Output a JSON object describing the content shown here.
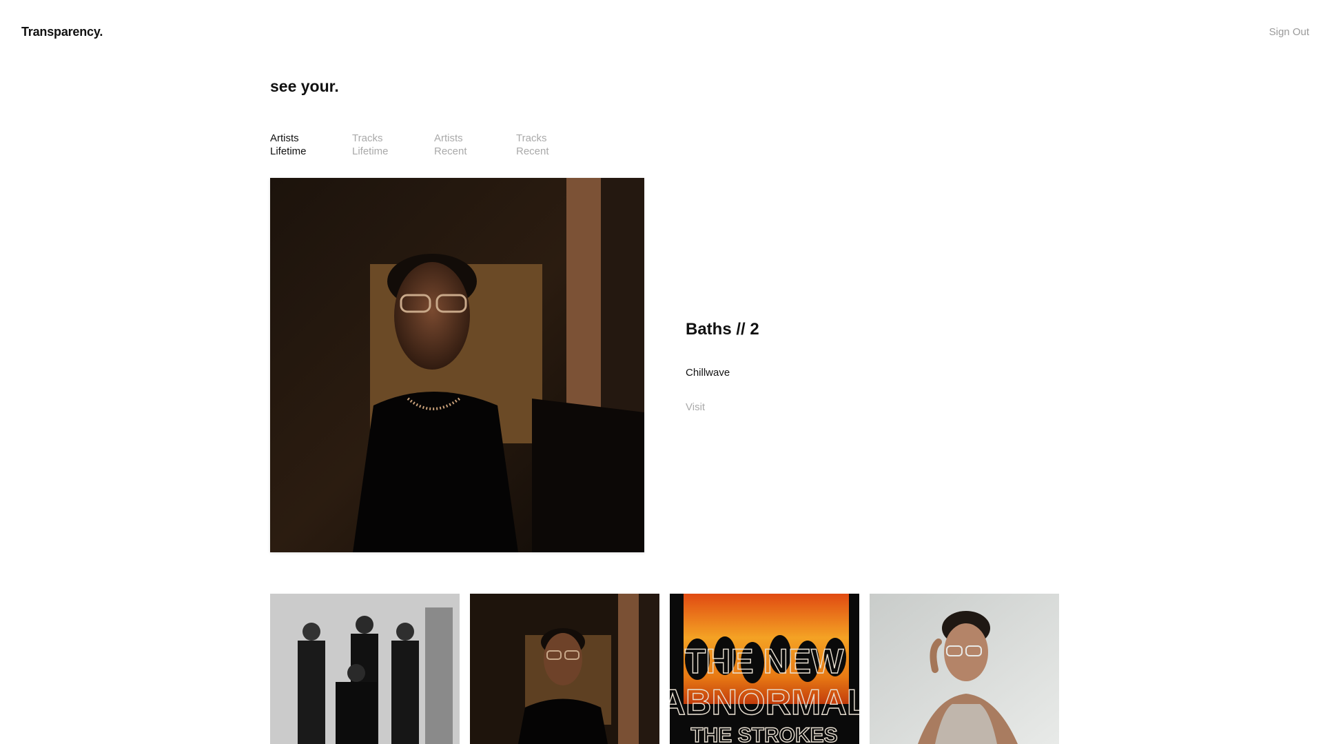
{
  "header": {
    "logo": "Transparency.",
    "sign_out": "Sign Out"
  },
  "heading": "see your.",
  "tabs": [
    {
      "line1": "Artists",
      "line2": "Lifetime",
      "active": true
    },
    {
      "line1": "Tracks",
      "line2": "Lifetime",
      "active": false
    },
    {
      "line1": "Artists",
      "line2": "Recent",
      "active": false
    },
    {
      "line1": "Tracks",
      "line2": "Recent",
      "active": false
    }
  ],
  "featured": {
    "title": "Baths // 2",
    "genre": "Chillwave",
    "visit": "Visit",
    "image": "artist-portrait-warm-light"
  },
  "thumbnails": [
    {
      "image": "band-photo-black-and-white"
    },
    {
      "image": "artist-portrait-warm-light"
    },
    {
      "image": "album-cover-the-new-abnormal",
      "cover_text": [
        "THE NEW",
        "ABNORMAL",
        "THE STROKES"
      ]
    },
    {
      "image": "artist-portrait-glasses-light-background"
    }
  ],
  "colors": {
    "text": "#111111",
    "muted": "#a9a9a9",
    "background": "#ffffff",
    "cover_orange": "#f08a1a"
  }
}
